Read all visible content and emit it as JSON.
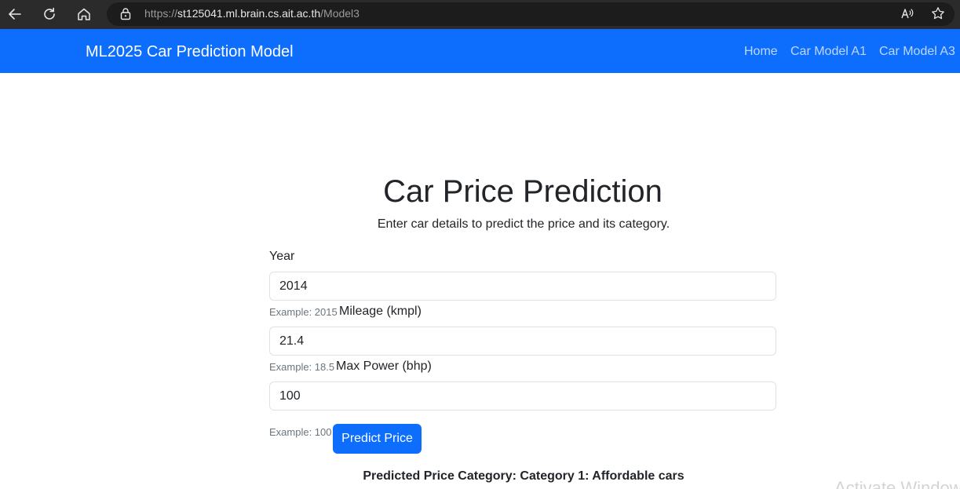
{
  "browser": {
    "url_scheme": "https://",
    "url_domain": "st125041.ml.brain.cs.ait.ac.th",
    "url_path": "/Model3"
  },
  "navbar": {
    "brand": "ML2025 Car Prediction Model",
    "links": [
      {
        "label": "Home"
      },
      {
        "label": "Car Model A1"
      },
      {
        "label": "Car Model A3"
      }
    ],
    "color": "#0d6efd"
  },
  "main": {
    "title": "Car Price Prediction",
    "subtitle": "Enter car details to predict the price and its category.",
    "fields": [
      {
        "label": "Year",
        "value": "2014",
        "help": "Example: 2015"
      },
      {
        "label": "Mileage (kmpl)",
        "value": "21.4",
        "help": "Example: 18.5"
      },
      {
        "label": "Max Power (bhp)",
        "value": "100",
        "help": "Example: 100"
      }
    ],
    "submit_label": "Predict Price",
    "result": "Predicted Price Category: Category 1: Affordable cars"
  },
  "os_overlay": {
    "watermark": "Activate Windows"
  },
  "icons": [
    "back-arrow-icon",
    "refresh-icon",
    "home-icon",
    "lock-icon",
    "read-aloud-icon",
    "favorite-star-icon"
  ]
}
